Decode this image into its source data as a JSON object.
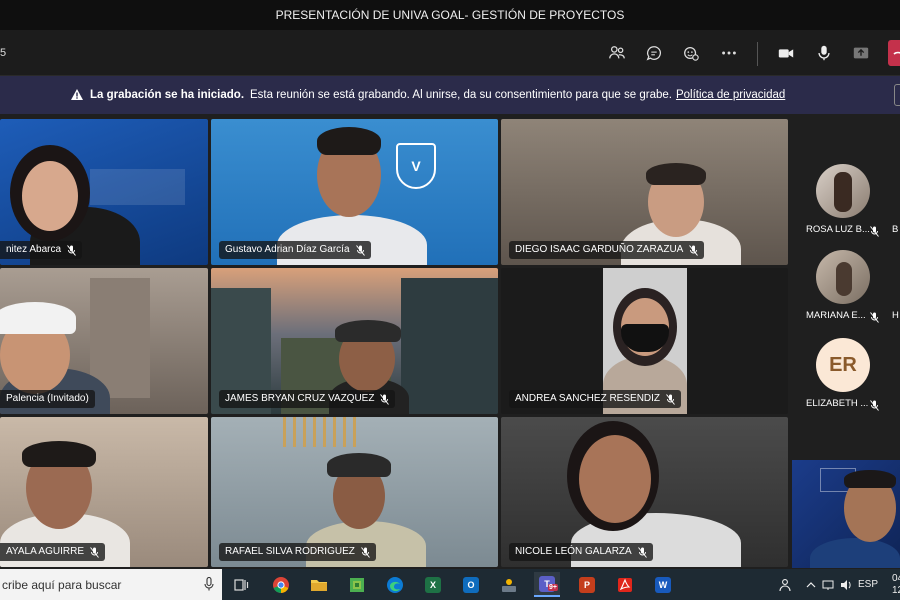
{
  "window": {
    "title": "PRESENTACIÓN DE UNIVA GOAL- GESTIÓN DE PROYECTOS"
  },
  "toolbar": {
    "timer": "5",
    "buttons": [
      "participants-icon",
      "chat-icon",
      "reactions-icon",
      "more-icon",
      "camera-icon",
      "microphone-icon",
      "share-icon",
      "leave-icon"
    ]
  },
  "banner": {
    "bold": "La grabación se ha iniciado.",
    "text": "Esta reunión se está grabando. Al unirse, da su consentimiento para que se grabe.",
    "link": "Política de privacidad"
  },
  "participants": [
    {
      "name": "nitez Abarca"
    },
    {
      "name": "Gustavo Adrian Díaz García"
    },
    {
      "name": "DIEGO ISAAC GARDUÑO ZARAZUA"
    },
    {
      "name": "Palencia (Invitado)"
    },
    {
      "name": "JAMES BRYAN CRUZ VAZQUEZ"
    },
    {
      "name": "ANDREA SANCHEZ RESENDIZ"
    },
    {
      "name": "AYALA AGUIRRE"
    },
    {
      "name": "RAFAEL SILVA RODRIGUEZ"
    },
    {
      "name": "NICOLE LEÓN GALARZA"
    }
  ],
  "rail": [
    {
      "name": "ROSA LUZ B...",
      "extra": "B"
    },
    {
      "name": "MARIANA E...",
      "extra": "H"
    },
    {
      "name": "ELIZABETH ...",
      "initials": "ER"
    }
  ],
  "taskbar": {
    "search_placeholder": "cribe aquí para buscar",
    "apps": [
      {
        "icon": "task-view-icon",
        "letter": ""
      },
      {
        "icon": "chrome-icon",
        "letter": ""
      },
      {
        "icon": "file-explorer-icon",
        "letter": ""
      },
      {
        "icon": "game-icon",
        "letter": ""
      },
      {
        "icon": "edge-icon",
        "letter": ""
      },
      {
        "icon": "excel-icon",
        "letter": "X"
      },
      {
        "icon": "outlook-icon",
        "letter": "O"
      },
      {
        "icon": "photos-icon",
        "letter": ""
      },
      {
        "icon": "teams-icon",
        "letter": "T",
        "badge": "9+"
      },
      {
        "icon": "powerpoint-icon",
        "letter": "P"
      },
      {
        "icon": "acrobat-icon",
        "letter": ""
      },
      {
        "icon": "word-icon",
        "letter": "W"
      }
    ],
    "language": "ESP",
    "clock_top": "04",
    "clock_bottom": "12"
  },
  "colors": {
    "banner": "#2b2b4a",
    "leave": "#c4314b",
    "teams_purple": "#5b5fc7",
    "excel": "#1e7145",
    "outlook": "#0f6cbd",
    "powerpoint": "#c43e1c",
    "word": "#185abd"
  }
}
